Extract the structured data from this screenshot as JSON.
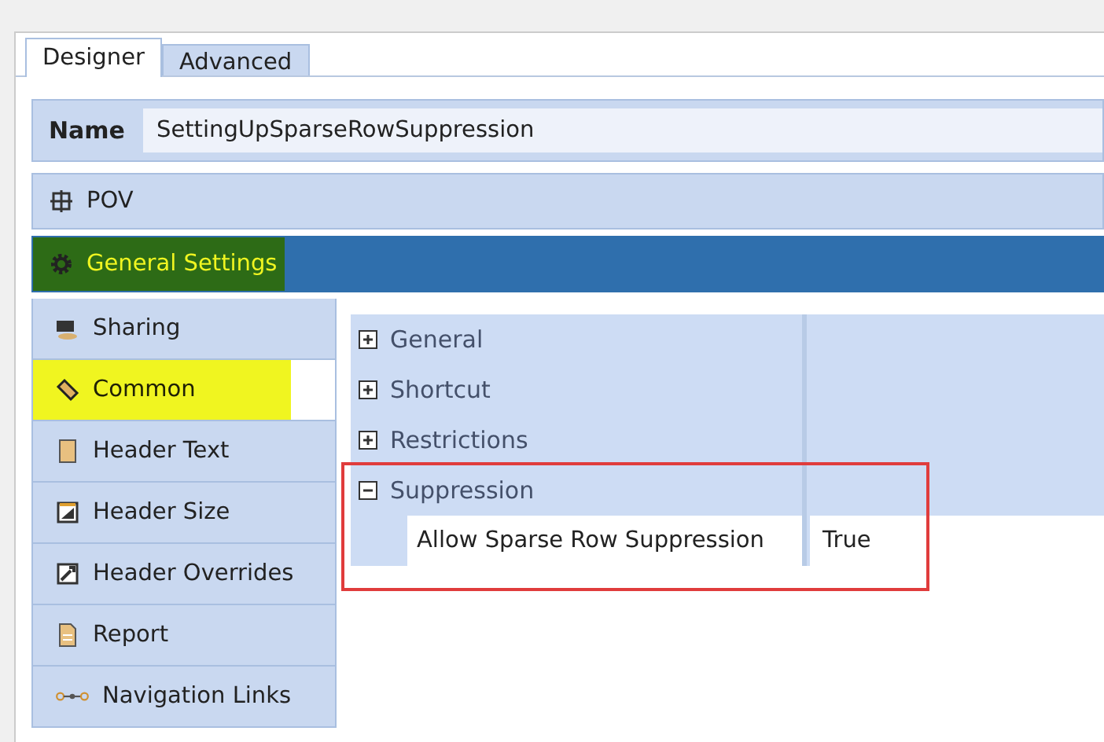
{
  "tabs": [
    {
      "label": "Designer",
      "selected": true
    },
    {
      "label": "Advanced",
      "selected": false
    }
  ],
  "name_field": {
    "label": "Name",
    "value": "SettingUpSparseRowSuppression"
  },
  "sections": [
    {
      "label": "POV",
      "kind": "pov",
      "selected": false,
      "highlighted": false
    },
    {
      "label": "General Settings",
      "kind": "gear",
      "selected": true,
      "highlighted": true
    }
  ],
  "sidebar": {
    "items": [
      {
        "label": "Sharing",
        "kind": "sharing",
        "selected": false,
        "highlighted": false
      },
      {
        "label": "Common",
        "kind": "tag",
        "selected": true,
        "highlighted": true
      },
      {
        "label": "Header Text",
        "kind": "text",
        "selected": false,
        "highlighted": false
      },
      {
        "label": "Header Size",
        "kind": "size",
        "selected": false,
        "highlighted": false
      },
      {
        "label": "Header Overrides",
        "kind": "override",
        "selected": false,
        "highlighted": false
      },
      {
        "label": "Report",
        "kind": "report",
        "selected": false,
        "highlighted": false
      },
      {
        "label": "Navigation Links",
        "kind": "links",
        "selected": false,
        "highlighted": false
      }
    ]
  },
  "property_grid": {
    "groups": [
      {
        "label": "General",
        "expanded": false,
        "outlined": false
      },
      {
        "label": "Shortcut",
        "expanded": false,
        "outlined": false
      },
      {
        "label": "Restrictions",
        "expanded": false,
        "outlined": false
      },
      {
        "label": "Suppression",
        "expanded": true,
        "outlined": true,
        "properties": [
          {
            "name": "Allow Sparse Row Suppression",
            "value": "True"
          }
        ]
      }
    ]
  }
}
